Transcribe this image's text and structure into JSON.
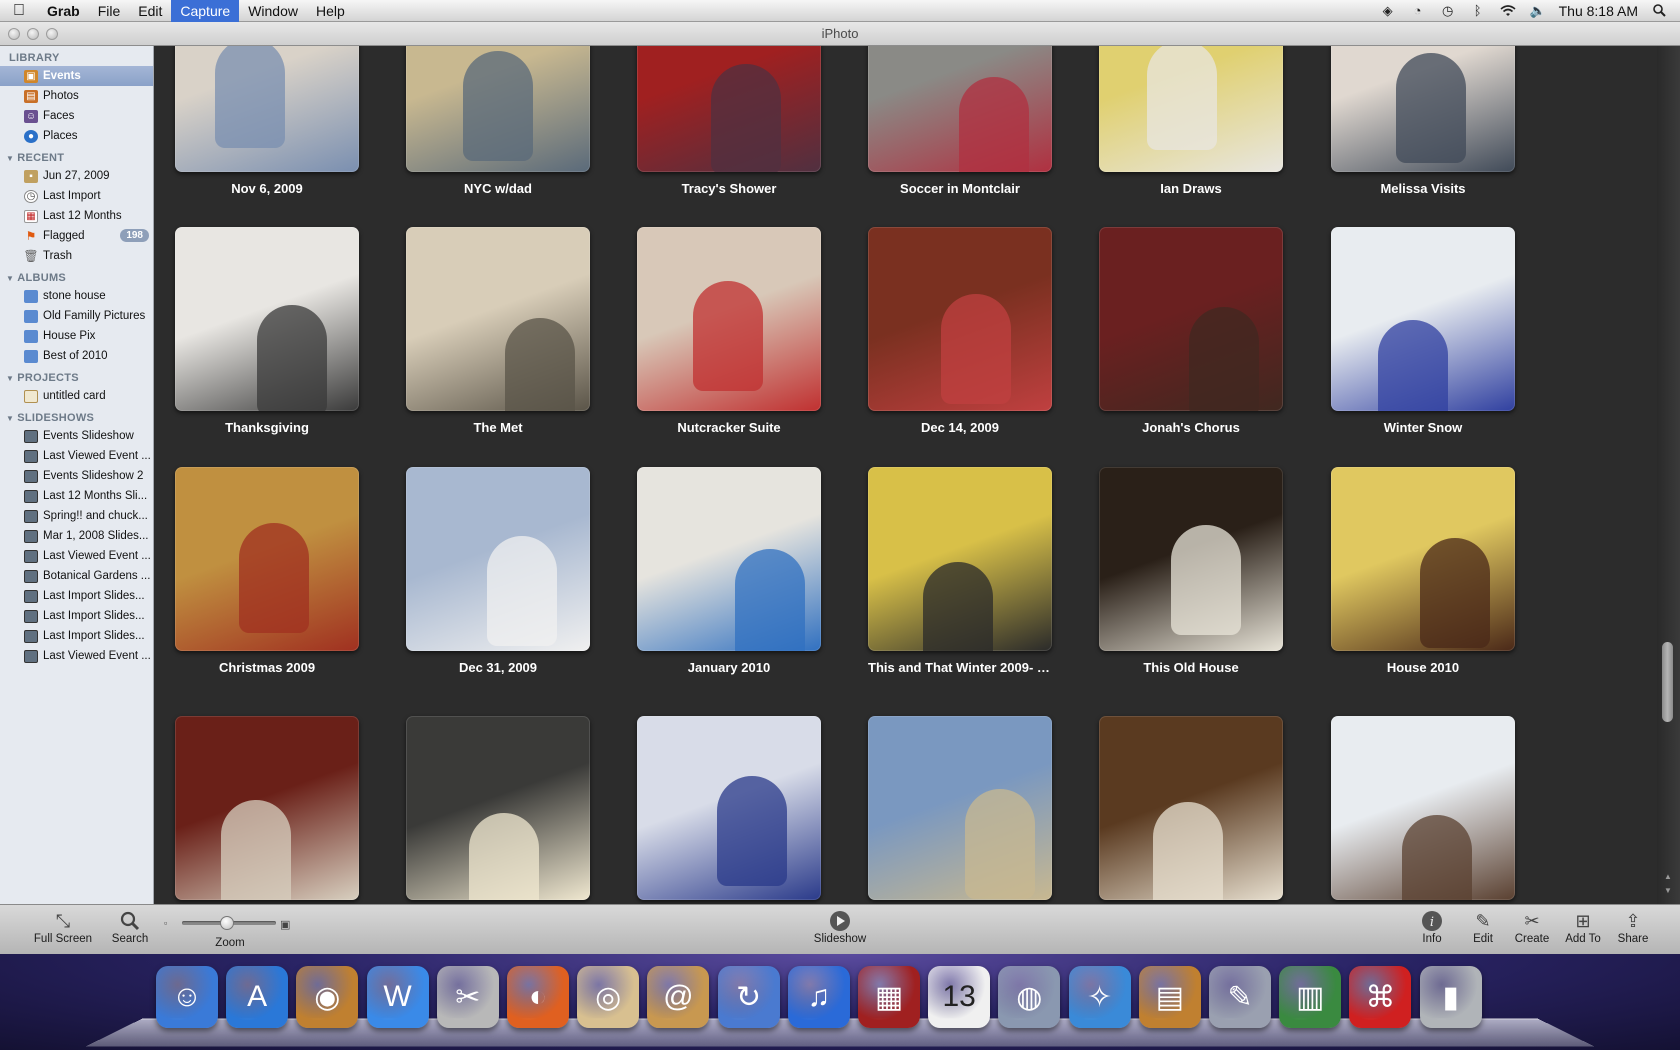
{
  "menubar": {
    "app_name": "Grab",
    "menus": [
      "File",
      "Edit",
      "Capture",
      "Window",
      "Help"
    ],
    "active_menu": "Capture",
    "clock": "Thu 8:18 AM"
  },
  "window": {
    "title": "iPhoto"
  },
  "sidebar": {
    "library": {
      "header": "LIBRARY",
      "items": [
        {
          "label": "Events",
          "icon": "events-icon",
          "selected": true
        },
        {
          "label": "Photos",
          "icon": "photos-icon"
        },
        {
          "label": "Faces",
          "icon": "faces-icon"
        },
        {
          "label": "Places",
          "icon": "places-icon"
        }
      ]
    },
    "recent": {
      "header": "RECENT",
      "items": [
        {
          "label": "Jun 27, 2009",
          "icon": "event-icon"
        },
        {
          "label": "Last Import",
          "icon": "clock-icon"
        },
        {
          "label": "Last 12 Months",
          "icon": "calendar-icon"
        },
        {
          "label": "Flagged",
          "icon": "flag-icon",
          "badge": "198"
        },
        {
          "label": "Trash",
          "icon": "trash-icon"
        }
      ]
    },
    "albums": {
      "header": "ALBUMS",
      "items": [
        {
          "label": "stone house"
        },
        {
          "label": "Old Familly Pictures"
        },
        {
          "label": "House Pix"
        },
        {
          "label": "Best of 2010"
        }
      ]
    },
    "projects": {
      "header": "PROJECTS",
      "items": [
        {
          "label": "untitled card"
        }
      ]
    },
    "slideshows": {
      "header": "SLIDESHOWS",
      "items": [
        {
          "label": "Events Slideshow"
        },
        {
          "label": "Last Viewed Event ..."
        },
        {
          "label": "Events Slideshow 2"
        },
        {
          "label": "Last 12 Months Sli..."
        },
        {
          "label": "Spring!! and chuck..."
        },
        {
          "label": "Mar 1, 2008 Slides..."
        },
        {
          "label": "Last Viewed Event ..."
        },
        {
          "label": "Botanical Gardens ..."
        },
        {
          "label": "Last Import Slides..."
        },
        {
          "label": "Last Import Slides..."
        },
        {
          "label": "Last Import Slides..."
        },
        {
          "label": "Last Viewed Event ..."
        }
      ]
    }
  },
  "events": [
    {
      "name": "Nov 6, 2009",
      "colors": [
        "#d9d2c8",
        "#7a8fb0"
      ]
    },
    {
      "name": "NYC w/dad",
      "colors": [
        "#c8b890",
        "#5a6a7a"
      ]
    },
    {
      "name": "Tracy's Shower",
      "colors": [
        "#a02020",
        "#503040"
      ]
    },
    {
      "name": "Soccer in Montclair",
      "colors": [
        "#8a8a86",
        "#b03040"
      ]
    },
    {
      "name": "Ian Draws",
      "colors": [
        "#e0d070",
        "#e8e6e0"
      ]
    },
    {
      "name": "Melissa Visits",
      "colors": [
        "#e0d8d0",
        "#404a58"
      ]
    },
    {
      "name": "Thanksgiving",
      "colors": [
        "#e8e6e2",
        "#3a3a3a"
      ]
    },
    {
      "name": "The Met",
      "colors": [
        "#d8cdb8",
        "#5a5448"
      ]
    },
    {
      "name": "Nutcracker Suite",
      "colors": [
        "#d8c8b8",
        "#c03030"
      ]
    },
    {
      "name": "Dec 14, 2009",
      "colors": [
        "#7a3020",
        "#c04040"
      ]
    },
    {
      "name": "Jonah's Chorus",
      "colors": [
        "#6a2020",
        "#402820"
      ]
    },
    {
      "name": "Winter Snow",
      "colors": [
        "#e8ecf0",
        "#3040a0"
      ]
    },
    {
      "name": "Christmas 2009",
      "colors": [
        "#c09040",
        "#a03020"
      ]
    },
    {
      "name": "Dec 31, 2009",
      "colors": [
        "#a8b8d0",
        "#f0f0f0"
      ]
    },
    {
      "name": "January 2010",
      "colors": [
        "#e6e4de",
        "#3070c0"
      ]
    },
    {
      "name": "This and That Winter 2009- 2...",
      "colors": [
        "#d8c048",
        "#2a2a2a"
      ]
    },
    {
      "name": "This Old House",
      "colors": [
        "#2a2018",
        "#e8e4d8"
      ]
    },
    {
      "name": "House 2010",
      "colors": [
        "#e0c860",
        "#4a2818"
      ]
    },
    {
      "name": "",
      "colors": [
        "#6a2018",
        "#d8d0c0"
      ]
    },
    {
      "name": "",
      "colors": [
        "#3a3a38",
        "#f0e8d0"
      ]
    },
    {
      "name": "",
      "colors": [
        "#d8dce8",
        "#2a3a8a"
      ]
    },
    {
      "name": "",
      "colors": [
        "#7a98c0",
        "#c8b890"
      ]
    },
    {
      "name": "",
      "colors": [
        "#5a3a20",
        "#e8e0d0"
      ]
    },
    {
      "name": "",
      "colors": [
        "#e8ecf0",
        "#5a4030"
      ]
    }
  ],
  "toolbar": {
    "full_screen": "Full Screen",
    "search": "Search",
    "zoom": "Zoom",
    "slideshow": "Slideshow",
    "info": "Info",
    "edit": "Edit",
    "create": "Create",
    "add_to": "Add To",
    "share": "Share"
  },
  "dock": {
    "apps": [
      {
        "name": "finder-icon",
        "color": "#3a7ad8",
        "glyph": "☺"
      },
      {
        "name": "app-store-icon",
        "color": "#2a78d8",
        "glyph": "A"
      },
      {
        "name": "iphoto-icon",
        "color": "#c08030",
        "glyph": "◉"
      },
      {
        "name": "word-icon",
        "color": "#3a8ae8",
        "glyph": "W"
      },
      {
        "name": "scissors-icon",
        "color": "#b8b8b8",
        "glyph": "✂"
      },
      {
        "name": "firefox-icon",
        "color": "#e06020",
        "glyph": "◐"
      },
      {
        "name": "preview-icon",
        "color": "#d8c090",
        "glyph": "◎"
      },
      {
        "name": "address-book-icon",
        "color": "#c89850",
        "glyph": "@"
      },
      {
        "name": "time-machine-icon",
        "color": "#4a7ad0",
        "glyph": "↻"
      },
      {
        "name": "itunes-icon",
        "color": "#2a6ad8",
        "glyph": "♫"
      },
      {
        "name": "photo-booth-icon",
        "color": "#a02020",
        "glyph": "▦"
      },
      {
        "name": "ical-icon",
        "color": "#f0f0f0",
        "glyph": "13"
      },
      {
        "name": "image-capture-icon",
        "color": "#8a98b0",
        "glyph": "◍"
      },
      {
        "name": "safari-icon",
        "color": "#3a8ad8",
        "glyph": "✧"
      },
      {
        "name": "keynote-icon",
        "color": "#c08030",
        "glyph": "▤"
      },
      {
        "name": "pen-icon",
        "color": "#9aa0b0",
        "glyph": "✎"
      },
      {
        "name": "numbers-icon",
        "color": "#3a8a40",
        "glyph": "▥"
      },
      {
        "name": "acrobat-icon",
        "color": "#d02020",
        "glyph": "⌘"
      },
      {
        "name": "trash-dock-icon",
        "color": "#b0b4b8",
        "glyph": "▮"
      }
    ]
  }
}
